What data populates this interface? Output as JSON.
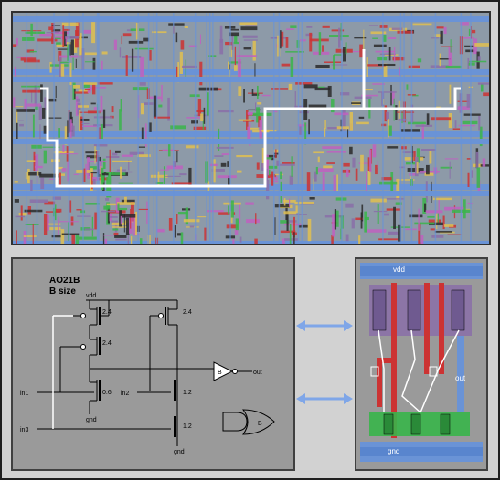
{
  "schematic": {
    "cell_name": "AO21B",
    "cell_size": "B size",
    "supply_label": "vdd",
    "ground_label": "gnd",
    "inputs": [
      "in1",
      "in2",
      "in3"
    ],
    "output": "out",
    "buffer_label": "B",
    "gate_symbol_label": "B",
    "transistor_sizes": {
      "p_top_left": "2.4",
      "p_top_right": "2.4",
      "p_mid_left": "2.4",
      "n_in1": "0.6",
      "n_in2": "1.2",
      "n_in3": "1.2"
    }
  },
  "cell_layout": {
    "supply_label": "vdd",
    "ground_label": "gnd",
    "output_label": "out"
  },
  "colors": {
    "metal_blue": "#6a93d6",
    "poly_red": "#cc3333",
    "diffusion_green": "#39b54a",
    "well_purple": "#8a6ea8",
    "arrow_blue": "#7fa6e8",
    "route_white": "#ffffff"
  }
}
